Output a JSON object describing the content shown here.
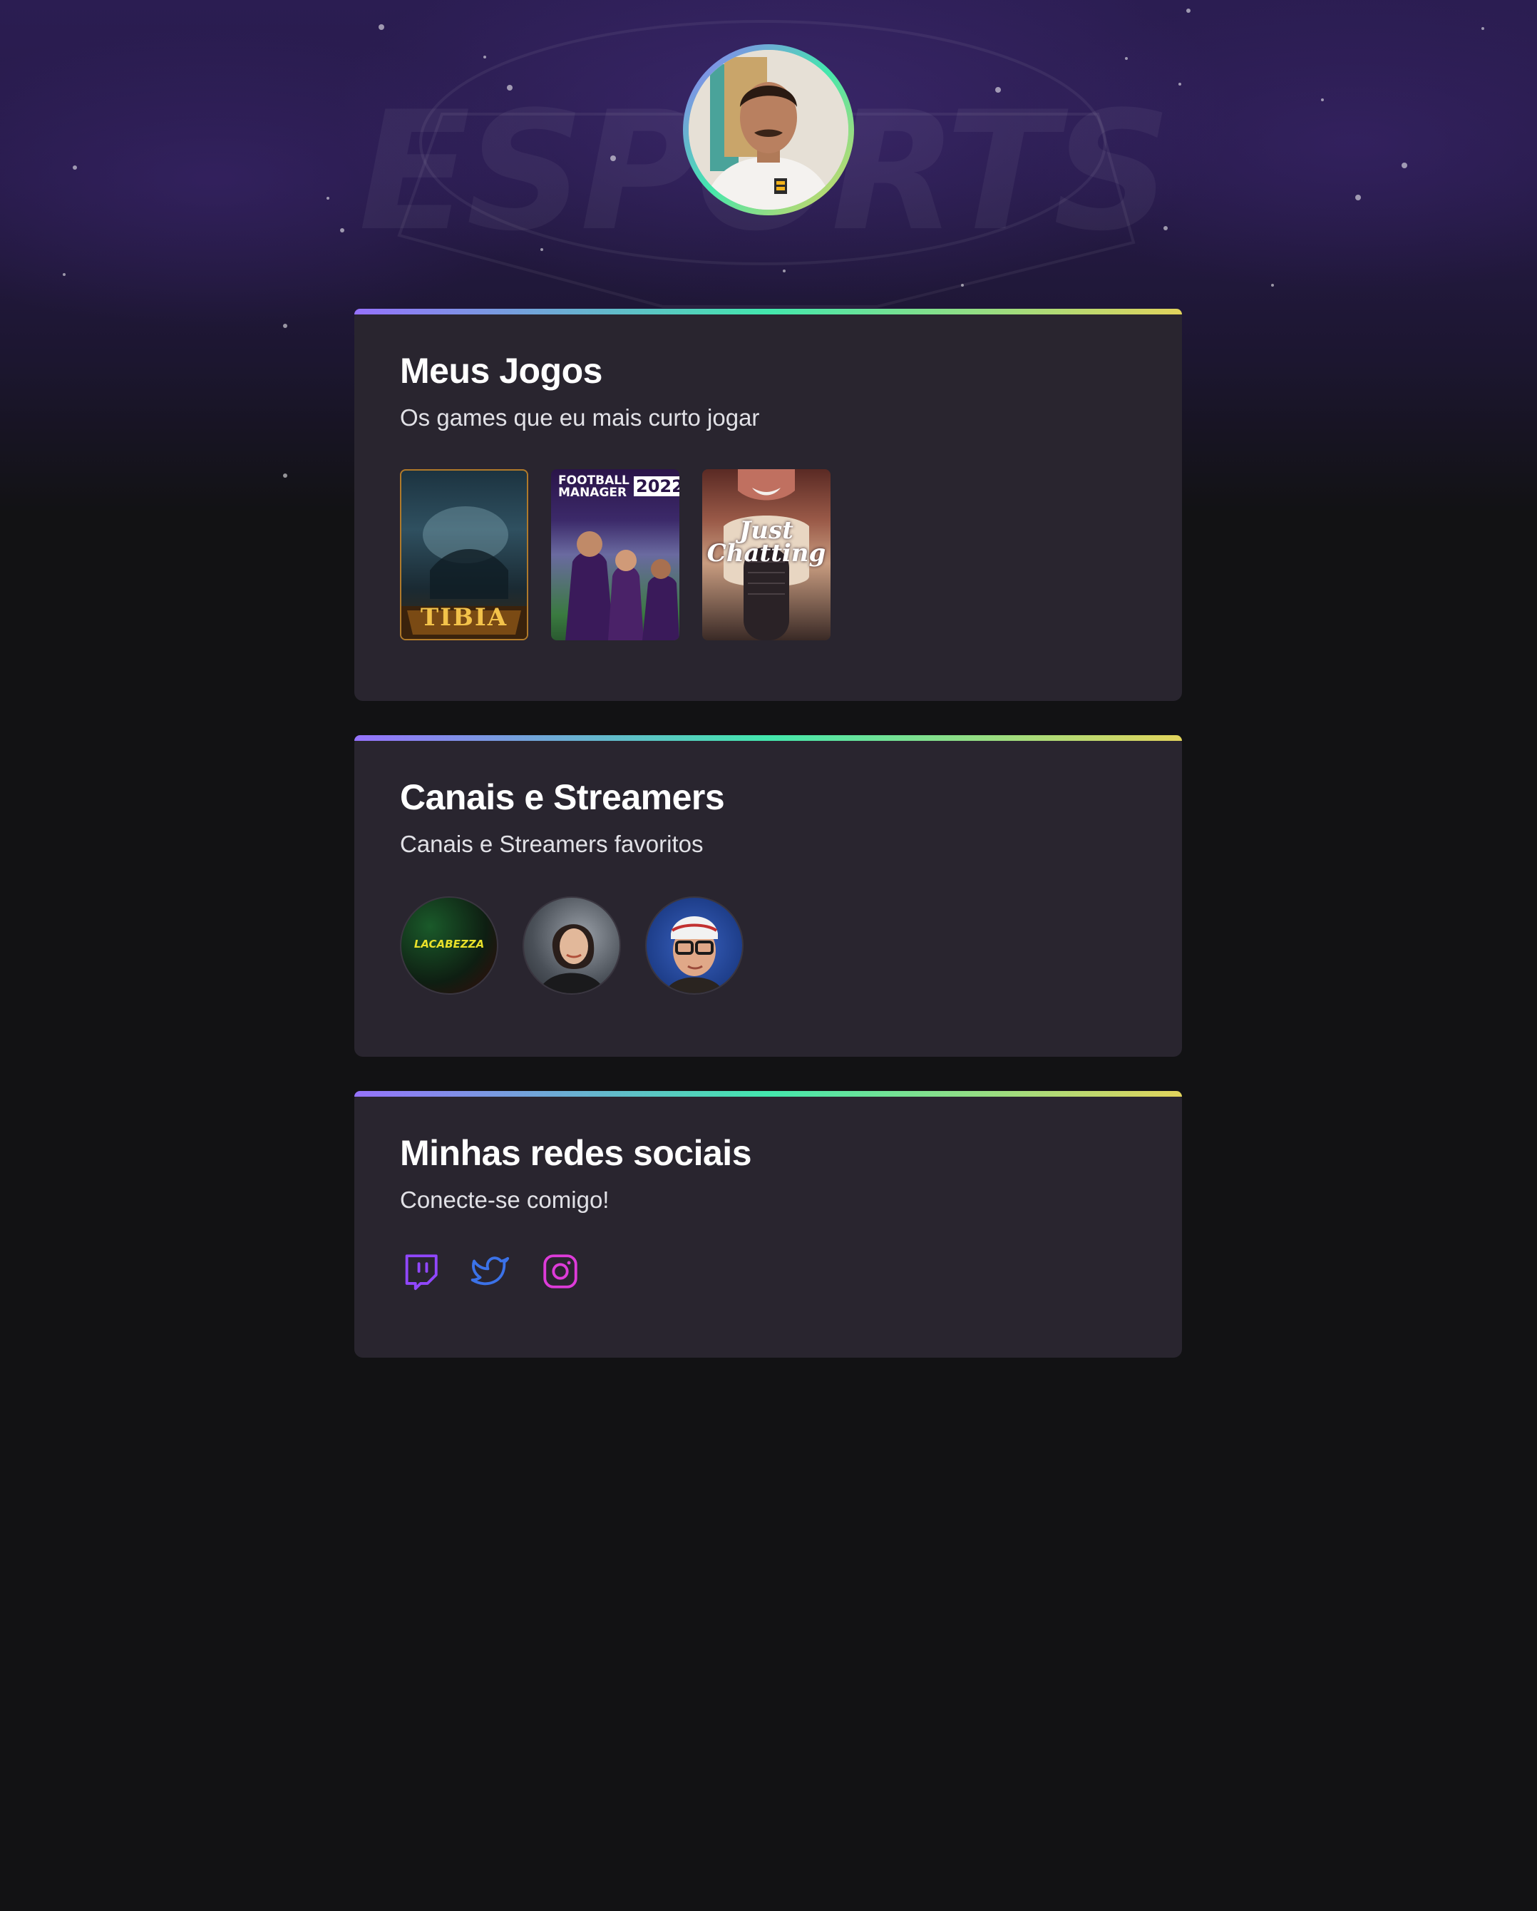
{
  "profile": {
    "avatar_alt": "profile-photo"
  },
  "hero": {
    "watermark_text": "ESPORTS"
  },
  "sections": {
    "games": {
      "title": "Meus Jogos",
      "subtitle": "Os games que eu mais curto jogar",
      "items": [
        {
          "name": "Tibia",
          "label": "TIBIA"
        },
        {
          "name": "Football Manager 2022",
          "label_line1": "FOOTBALL",
          "label_line2": "MANAGER",
          "label_year": "2022"
        },
        {
          "name": "Just Chatting",
          "label_line1": "Just",
          "label_line2": "Chatting"
        }
      ]
    },
    "streamers": {
      "title": "Canais e Streamers",
      "subtitle": "Canais e Streamers favoritos",
      "items": [
        {
          "name": "LaCabezza",
          "label": "LACABEZZA"
        },
        {
          "name": "streamer-2"
        },
        {
          "name": "streamer-3"
        }
      ]
    },
    "social": {
      "title": "Minhas redes sociais",
      "subtitle": "Conecte-se comigo!",
      "items": [
        {
          "name": "twitch",
          "icon": "twitch-icon",
          "color": "#9147ff"
        },
        {
          "name": "twitter",
          "icon": "twitter-icon",
          "color": "#3b72e8"
        },
        {
          "name": "instagram",
          "icon": "instagram-icon",
          "color": "#dd3bd9"
        }
      ]
    }
  },
  "colors": {
    "background": "#121214",
    "card": "#29252f",
    "gradient_start": "#9572fc",
    "gradient_mid": "#43e7ad",
    "gradient_end": "#e2d45c"
  }
}
